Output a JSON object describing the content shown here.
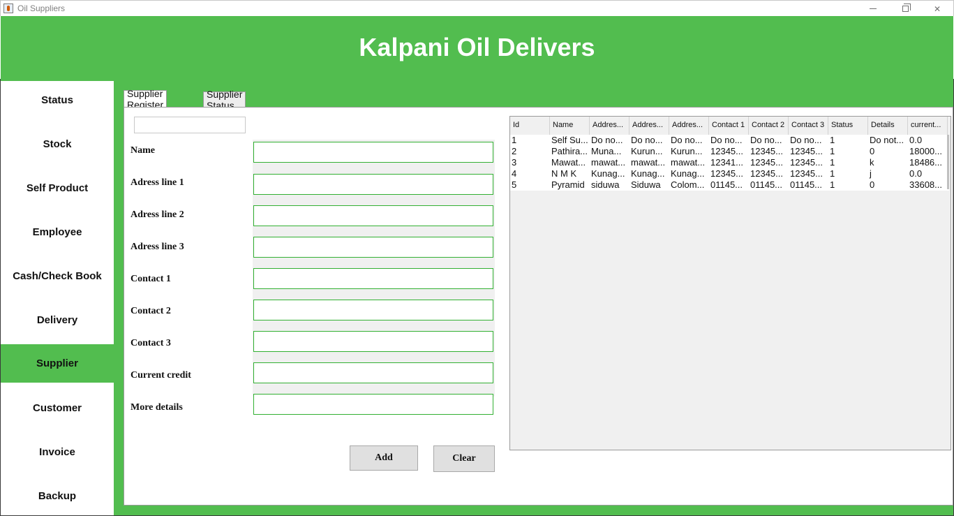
{
  "window": {
    "title": "Oil Suppliers"
  },
  "header": {
    "brand": "Kalpani Oil Delivers"
  },
  "sidebar": {
    "items": [
      {
        "label": "Status",
        "active": false
      },
      {
        "label": "Stock",
        "active": false
      },
      {
        "label": "Self Product",
        "active": false
      },
      {
        "label": "Employee",
        "active": false
      },
      {
        "label": "Cash/Check Book",
        "active": false
      },
      {
        "label": "Delivery",
        "active": false
      },
      {
        "label": "Supplier",
        "active": true
      },
      {
        "label": "Customer",
        "active": false
      },
      {
        "label": "Invoice",
        "active": false
      },
      {
        "label": "Backup",
        "active": false
      }
    ]
  },
  "tabs": [
    {
      "label": "Supplier Register",
      "selected": true
    },
    {
      "label": "Supplier Status",
      "selected": false
    }
  ],
  "form": {
    "search_value": "",
    "fields": [
      {
        "label": "Name",
        "value": ""
      },
      {
        "label": "Adress line 1",
        "value": ""
      },
      {
        "label": "Adress line 2",
        "value": ""
      },
      {
        "label": "Adress line 3",
        "value": ""
      },
      {
        "label": "Contact 1",
        "value": ""
      },
      {
        "label": "Contact 2",
        "value": ""
      },
      {
        "label": "Contact 3",
        "value": ""
      },
      {
        "label": "Current credit",
        "value": ""
      },
      {
        "label": "More details",
        "value": ""
      }
    ],
    "add_label": "Add",
    "clear_label": "Clear"
  },
  "table": {
    "columns": [
      "Id",
      "Name",
      "Addres...",
      "Addres...",
      "Addres...",
      "Contact 1",
      "Contact 2",
      "Contact 3",
      "Status",
      "Details",
      "current..."
    ],
    "rows": [
      [
        "1",
        "Self Su...",
        "Do no...",
        "Do no...",
        "Do no...",
        "Do no...",
        "Do no...",
        "Do no...",
        "1",
        "Do not...",
        "0.0"
      ],
      [
        "2",
        "Pathira...",
        "Muna...",
        "Kurun...",
        "Kurun...",
        "12345...",
        "12345...",
        "12345...",
        "1",
        "0",
        "18000..."
      ],
      [
        "3",
        "Mawat...",
        "mawat...",
        "mawat...",
        "mawat...",
        "12341...",
        "12345...",
        "12345...",
        "1",
        "k",
        "18486..."
      ],
      [
        "4",
        "N M K",
        "Kunag...",
        "Kunag...",
        "Kunag...",
        "12345...",
        "12345...",
        "12345...",
        "1",
        "j",
        "0.0"
      ],
      [
        "5",
        "Pyramid",
        "siduwa",
        "Siduwa",
        "Colom...",
        "01145...",
        "01145...",
        "01145...",
        "1",
        "0",
        "33608..."
      ]
    ]
  },
  "colors": {
    "accent": "#52bd4f",
    "input_border": "#32b032"
  }
}
